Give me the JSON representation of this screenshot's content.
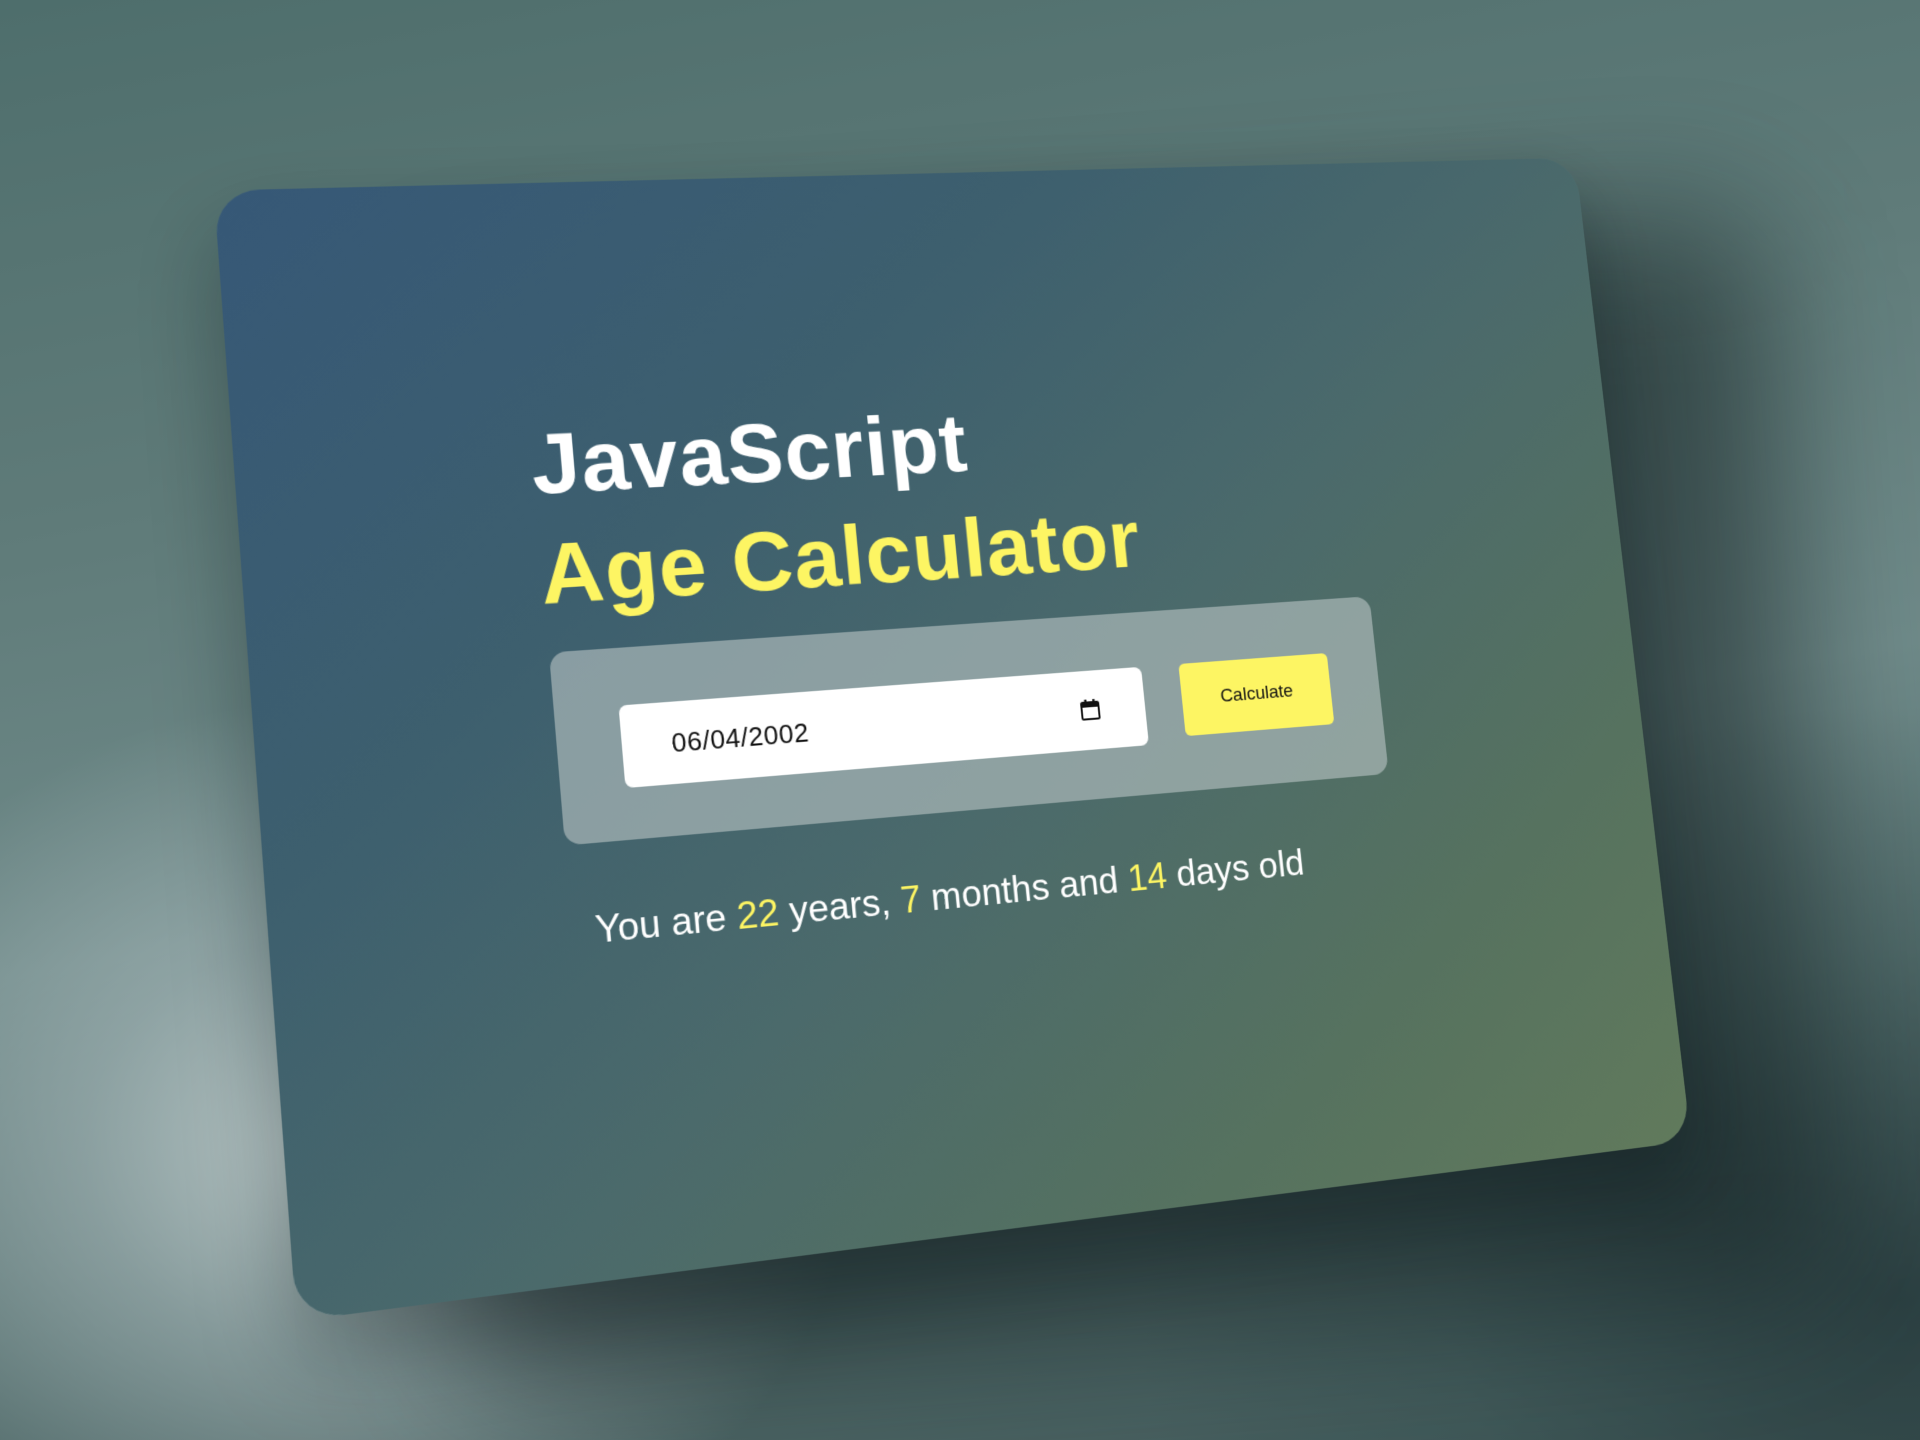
{
  "heading": {
    "line1": "JavaScript",
    "line2": "Age Calculator"
  },
  "form": {
    "date_value": "06/04/2002",
    "calculate_label": "Calculate"
  },
  "result": {
    "prefix": "You are ",
    "years": "22",
    "years_label": " years, ",
    "months": "7",
    "months_label": " months and ",
    "days": "14",
    "days_label": " days old"
  },
  "colors": {
    "accent": "#fdf563",
    "card_start": "#365877",
    "card_end": "#617a5c",
    "text": "#ffffff"
  },
  "icons": {
    "date_picker": "calendar-icon"
  }
}
